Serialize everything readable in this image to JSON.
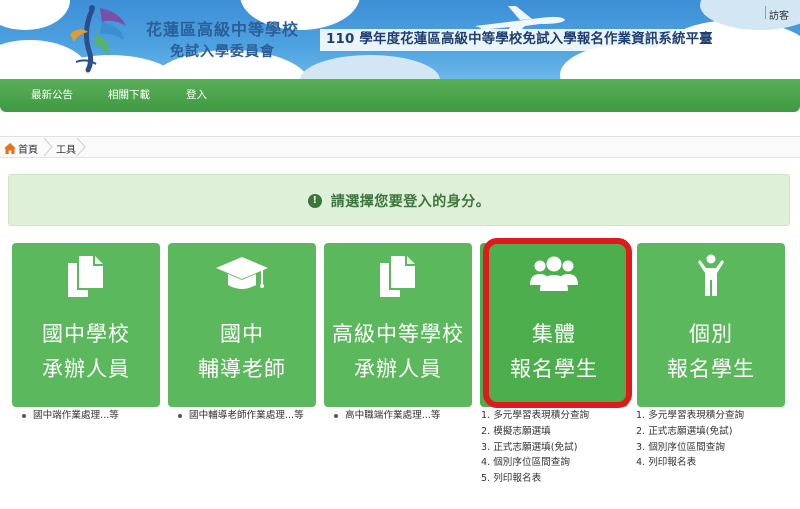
{
  "header": {
    "org_name": "花蓮區高級中等學校",
    "org_sub": "免試入學委員會",
    "site_title": "110 學年度花蓮區高級中等學校免試入學報名作業資訊系統平臺",
    "guest_link": "訪客"
  },
  "nav": {
    "items": [
      "最新公告",
      "相關下載",
      "登入"
    ]
  },
  "breadcrumb": {
    "home": "首頁",
    "current": "工具"
  },
  "alert": {
    "icon": "!",
    "message": "請選擇您要登入的身分。"
  },
  "cards": [
    {
      "icon": "document-icon",
      "line1": "國中學校",
      "line2": "承辦人員",
      "desc": [
        "國中端作業處理...等"
      ]
    },
    {
      "icon": "graduation-cap-icon",
      "line1": "國中",
      "line2": "輔導老師",
      "desc": [
        "國中輔導老師作業處理...等"
      ]
    },
    {
      "icon": "document-icon",
      "line1": "高級中等學校",
      "line2": "承辦人員",
      "desc": [
        "高中職端作業處理...等"
      ]
    },
    {
      "icon": "group-users-icon",
      "line1": "集體",
      "line2": "報名學生",
      "desc": [
        "1. 多元學習表現積分查詢",
        "2. 模擬志願選填",
        "3. 正式志願選填(免試)",
        "4. 個別序位區間查詢",
        "5. 列印報名表"
      ]
    },
    {
      "icon": "person-icon",
      "line1": "個別",
      "line2": "報名學生",
      "desc": [
        "1. 多元學習表現積分查詢",
        "2. 正式志願選填(免試)",
        "3. 個別序位區間查詢",
        "4. 列印報名表"
      ]
    }
  ],
  "colors": {
    "nav_green": "#3f9a40",
    "card_green": "#5cb85c",
    "alert_bg": "#dff0d8",
    "alert_text": "#3c763d",
    "highlight_red": "#e01a1a"
  }
}
